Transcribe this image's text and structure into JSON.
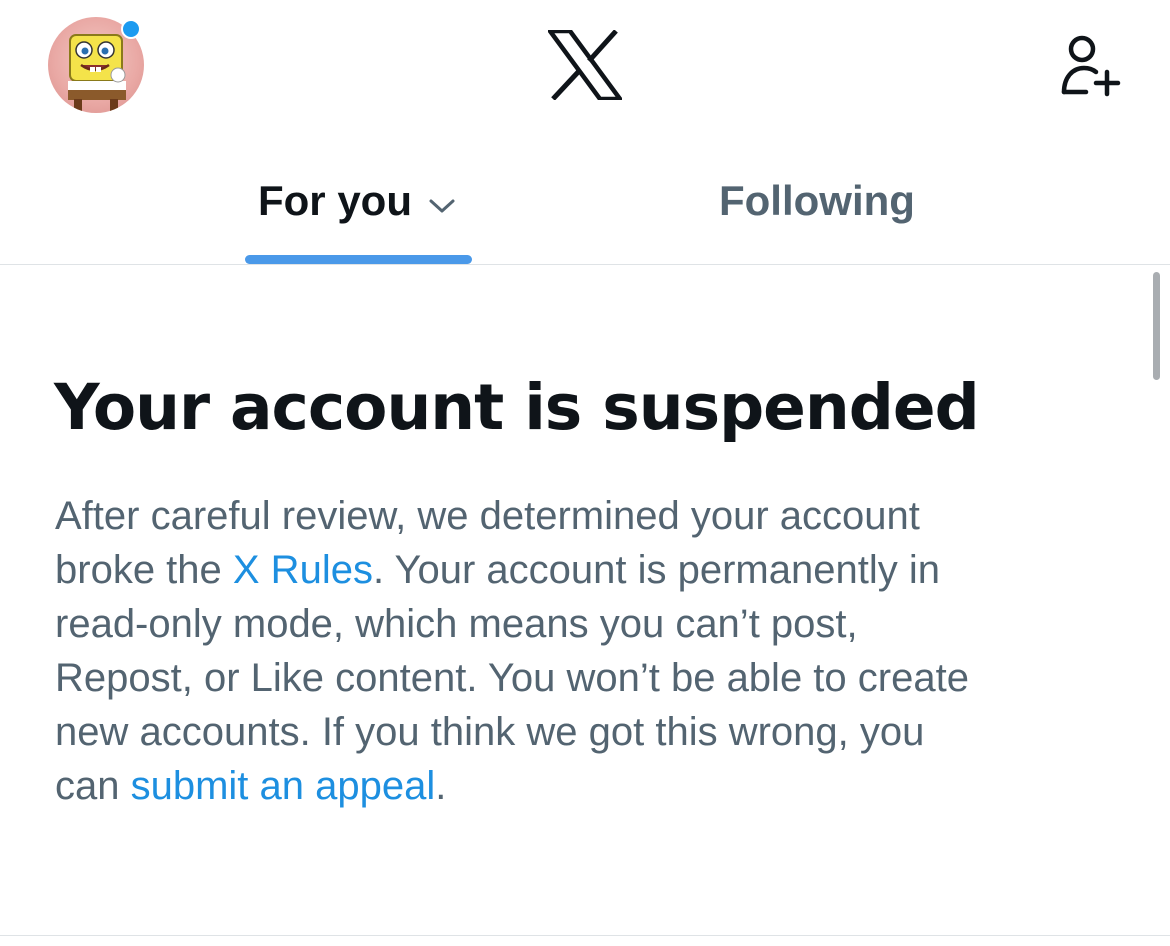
{
  "header": {
    "avatar": "user-avatar",
    "logo": "x-logo-icon",
    "add_user_icon": "add-user-icon"
  },
  "tabs": [
    {
      "label": "For you",
      "active": true
    },
    {
      "label": "Following",
      "active": false
    }
  ],
  "notice": {
    "title": "Your account is suspended",
    "line1": "After careful review, we determined your account",
    "line2_pre": "broke the ",
    "rules_link": "X Rules",
    "line2_post": ". Your account is permanently in",
    "line3": "read-only mode, which means you can’t post,",
    "line4": "Repost, or Like content. You won’t be able to create",
    "line5": "new accounts. If you think we got this wrong, you",
    "line6_pre": "can ",
    "appeal_link": "submit an appeal",
    "line6_post": "."
  },
  "colors": {
    "accent": "#1d9bf0",
    "link": "#1d8fe0",
    "text_primary": "#0f1419",
    "text_secondary": "#536471"
  }
}
